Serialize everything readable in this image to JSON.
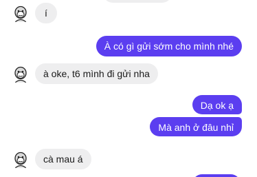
{
  "messages": [
    {
      "side": "in",
      "text": "í"
    },
    {
      "side": "out",
      "text": "À có gì gửi sớm cho mình nhé"
    },
    {
      "side": "in",
      "text": "à oke, t6 mình đi gửi nha"
    },
    {
      "side": "out",
      "text": "Dạ ok ạ"
    },
    {
      "side": "out",
      "text": "Mà anh ở đâu nhỉ"
    },
    {
      "side": "in",
      "text": "cà mau á"
    }
  ],
  "colors": {
    "incoming_bubble": "#eeeeef",
    "outgoing_bubble": "#5b3ef0",
    "outgoing_text": "#ffffff",
    "incoming_text": "#1a1a1a"
  },
  "icons": {
    "avatar": "monkey-sketch-avatar-icon"
  }
}
